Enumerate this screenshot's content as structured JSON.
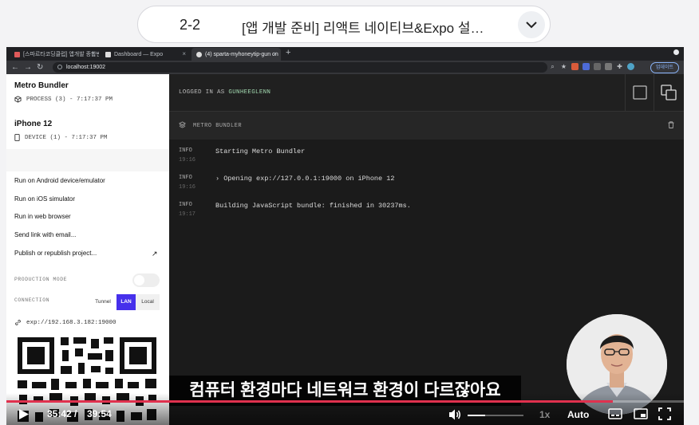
{
  "lecture": {
    "number": "2-2",
    "title": "[앱 개발 준비] 리액트 네이티브&Expo 설…"
  },
  "browser": {
    "tabs": [
      {
        "label": "[스파르타코딩클럽] 앱개발 종합반",
        "color": "#e05a5a"
      },
      {
        "label": "Dashboard — Expo",
        "color": "#dddddd"
      },
      {
        "label": "(4) sparta-myhoneytip-gun on",
        "color": "#dddddd"
      }
    ],
    "new_tab": "+",
    "url": "localhost:19002",
    "update_label": "업데이트"
  },
  "sidebar": {
    "bundler_title": "Metro Bundler",
    "bundler_status": "PROCESS (3) - 7:17:37 PM",
    "device_title": "iPhone 12",
    "device_status": "DEVICE (1) - 7:17:37 PM",
    "actions": [
      "Run on Android device/emulator",
      "Run on iOS simulator",
      "Run in web browser",
      "Send link with email...",
      "Publish or republish project..."
    ],
    "production_mode_label": "PRODUCTION MODE",
    "connection_label": "CONNECTION",
    "connection_options": [
      "Tunnel",
      "LAN",
      "Local"
    ],
    "connection_selected": "LAN",
    "exp_url": "exp://192.168.3.182:19000"
  },
  "console": {
    "logged_in_prefix": "LOGGED IN AS",
    "username": "GUNHEEGLENN",
    "panel_title": "METRO BUNDLER",
    "logs": [
      {
        "level": "INFO",
        "time": "19:16",
        "message": "Starting Metro Bundler"
      },
      {
        "level": "INFO",
        "time": "19:16",
        "message": "› Opening exp://127.0.0.1:19000 on iPhone 12"
      },
      {
        "level": "INFO",
        "time": "19:17",
        "message": "Building JavaScript bundle: finished in 30237ms."
      }
    ]
  },
  "video": {
    "subtitle": "컴퓨터 환경마다 네트워크 환경이 다르잖아요",
    "current_time": "35:42 /",
    "total_time": "39:54",
    "progress_fraction": 0.895,
    "volume_fraction": 0.32,
    "speed": "1x",
    "quality": "Auto",
    "accent_color": "#e0314e"
  }
}
